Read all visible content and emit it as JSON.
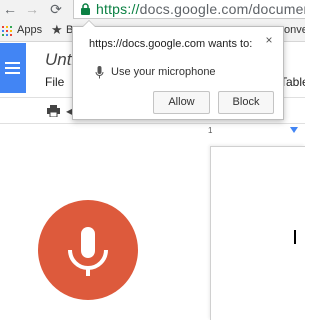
{
  "browser": {
    "url_scheme": "https://",
    "url_rest": "docs.google.com/document",
    "nav": {
      "back": "←",
      "forward": "→",
      "reload": "⟳"
    }
  },
  "bookmarks": {
    "apps_label": "Apps",
    "item_partial": "B",
    "right_partial": "onver"
  },
  "docs": {
    "title_partial": "Untit",
    "menu_file": "File",
    "menu_table_partial": "Table",
    "ruler_number": "1",
    "brand_color": "#4285f4",
    "mic_color": "#dd5a3c"
  },
  "permission_popup": {
    "title": "https://docs.google.com wants to:",
    "permission": "Use your microphone",
    "close": "×",
    "allow_label": "Allow",
    "block_label": "Block"
  }
}
